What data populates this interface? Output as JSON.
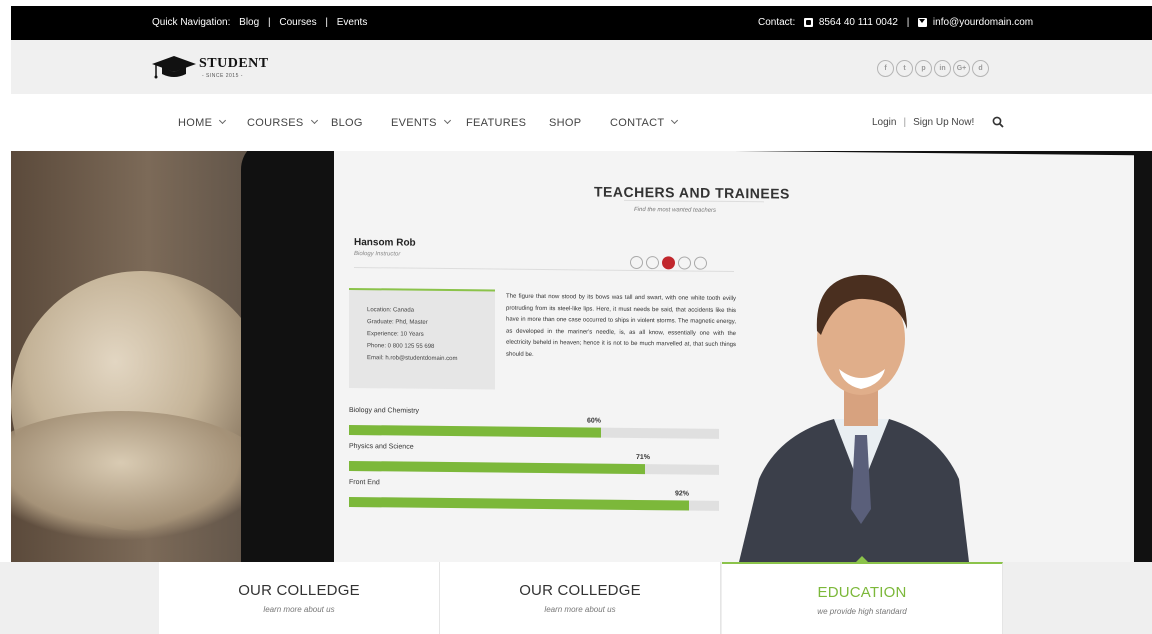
{
  "topbar": {
    "nav_label": "Quick Navigation:",
    "links": [
      "Blog",
      "Courses",
      "Events"
    ],
    "contact_label": "Contact:",
    "phone": "8564 40 111 0042",
    "email": "info@yourdomain.com"
  },
  "logo": {
    "name": "STUDENT",
    "tagline": "- SINCE 2015 -"
  },
  "socials": [
    "f",
    "t",
    "p",
    "in",
    "G+",
    "d"
  ],
  "nav": {
    "items": [
      {
        "label": "HOME",
        "has_dropdown": true
      },
      {
        "label": "COURSES",
        "has_dropdown": true
      },
      {
        "label": "BLOG",
        "has_dropdown": false
      },
      {
        "label": "EVENTS",
        "has_dropdown": true
      },
      {
        "label": "FEATURES",
        "has_dropdown": false
      },
      {
        "label": "SHOP",
        "has_dropdown": false
      },
      {
        "label": "CONTACT",
        "has_dropdown": true
      }
    ],
    "login": "Login",
    "signup": "Sign Up Now!"
  },
  "screen": {
    "title": "TEACHERS AND TRAINEES",
    "subtitle": "Find the most wanted teachers",
    "teacher_name": "Hansom Rob",
    "teacher_role": "Biology Instructor",
    "info": [
      "Location: Canada",
      "Graduate: Phd, Master",
      "Experience: 10 Years",
      "Phone: 0 800 125 55 698",
      "Email: h.rob@studentdomain.com"
    ],
    "paragraph": "The figure that now stood by its bows was tall and swart, with one white tooth evilly protruding from its steel-like lips. Here, it must needs be said, that accidents like this have in more than one case occurred to ships in violent storms. The magnetic energy, as developed in the mariner's needle, is, as all know, essentially one with the electricity beheld in heaven; hence it is not to be much marvelled at, that such things should be.",
    "skills": [
      {
        "label": "Biology and Chemistry",
        "pct_text": "60%",
        "value": 0.68
      },
      {
        "label": "Physics and Science",
        "pct_text": "71%",
        "value": 0.8
      },
      {
        "label": "Front End",
        "pct_text": "92%",
        "value": 0.92
      }
    ]
  },
  "features": [
    {
      "title": "OUR COLLEDGE",
      "sub": "learn more about us",
      "active": false
    },
    {
      "title": "OUR COLLEDGE",
      "sub": "learn more about us",
      "active": false
    },
    {
      "title": "EDUCATION",
      "sub": "we provide high standard",
      "active": true
    }
  ],
  "colors": {
    "accent": "#7cb83a",
    "topbar": "#000000",
    "social_active": "#c1272d"
  }
}
